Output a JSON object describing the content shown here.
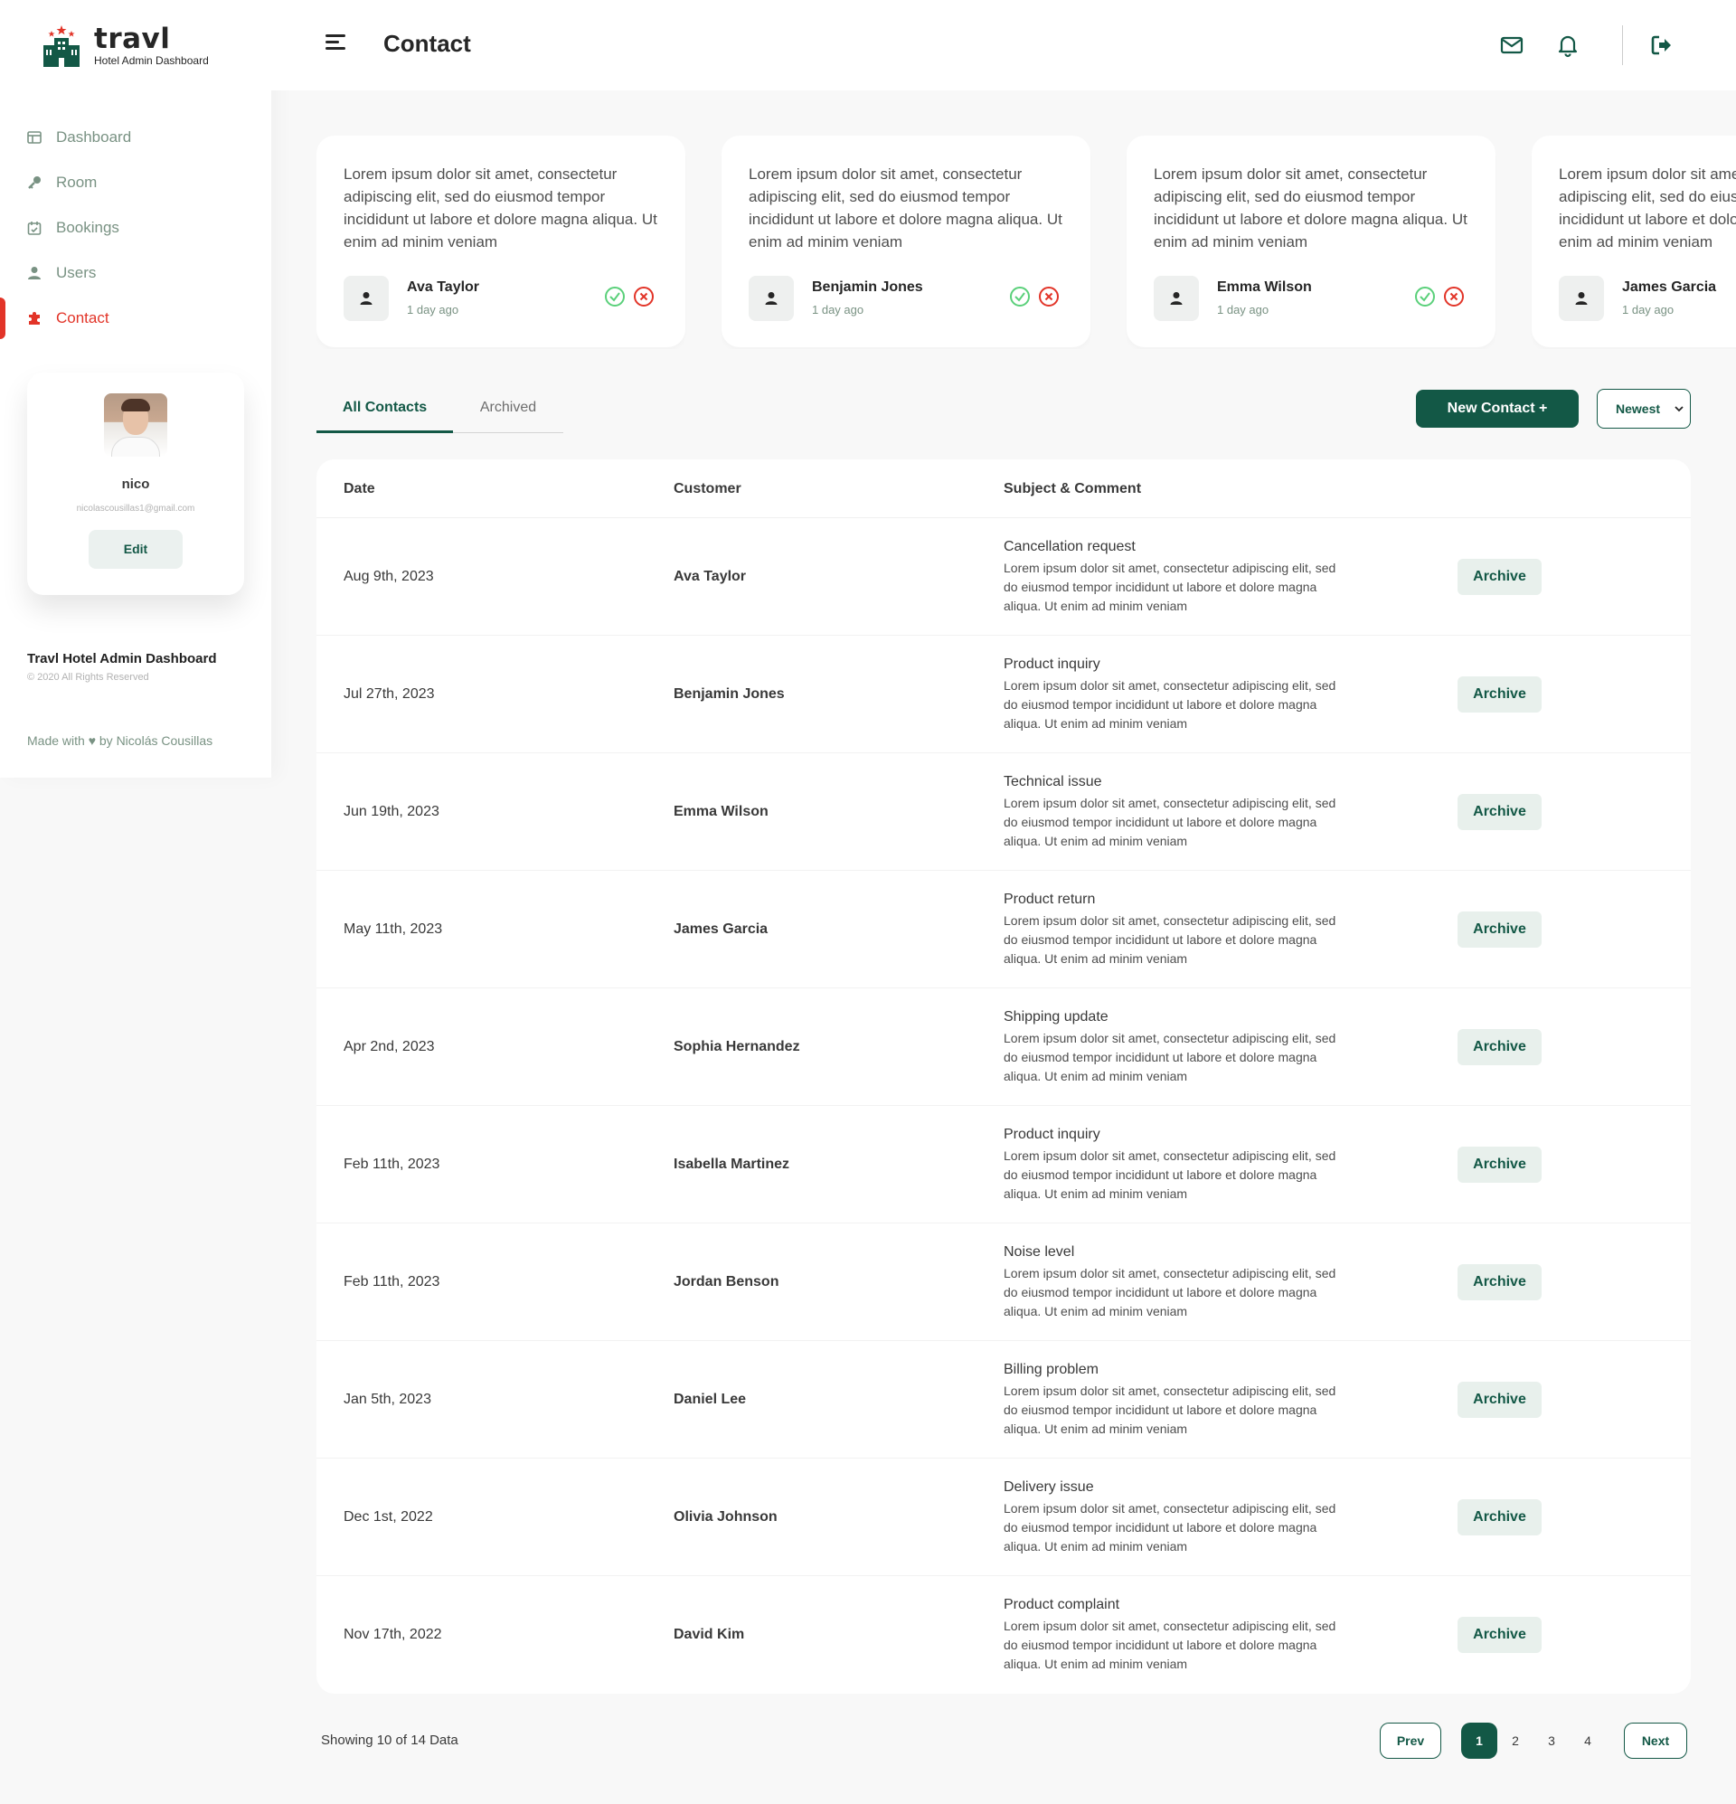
{
  "brand": {
    "name": "travl",
    "subtitle": "Hotel Admin Dashboard"
  },
  "sidebar": {
    "items": [
      {
        "label": "Dashboard",
        "icon": "dashboard-icon"
      },
      {
        "label": "Room",
        "icon": "key-icon"
      },
      {
        "label": "Bookings",
        "icon": "calendar-icon"
      },
      {
        "label": "Users",
        "icon": "user-icon"
      },
      {
        "label": "Contact",
        "icon": "puzzle-icon",
        "active": true
      }
    ],
    "user": {
      "name": "nico",
      "email": "nicolascousillas1@gmail.com",
      "edit_label": "Edit"
    },
    "footer": {
      "title": "Travl Hotel Admin Dashboard",
      "copyright": "© 2020 All Rights Reserved",
      "made": "Made with ♥ by Nicolás Cousillas"
    }
  },
  "header": {
    "title": "Contact"
  },
  "reviews": [
    {
      "text": "Lorem ipsum dolor sit amet, consectetur adipiscing elit, sed do eiusmod tempor incididunt ut labore et dolore magna aliqua. Ut enim ad minim veniam",
      "name": "Ava Taylor",
      "time": "1 day ago"
    },
    {
      "text": "Lorem ipsum dolor sit amet, consectetur adipiscing elit, sed do eiusmod tempor incididunt ut labore et dolore magna aliqua. Ut enim ad minim veniam",
      "name": "Benjamin Jones",
      "time": "1 day ago"
    },
    {
      "text": "Lorem ipsum dolor sit amet, consectetur adipiscing elit, sed do eiusmod tempor incididunt ut labore et dolore magna aliqua. Ut enim ad minim veniam",
      "name": "Emma Wilson",
      "time": "1 day ago"
    },
    {
      "text": "Lorem ipsum dolor sit amet, consectetur adipiscing elit, sed do eiusmod tempor incididunt ut labore et dolore magna aliqua. Ut enim ad minim veniam",
      "name": "James Garcia",
      "time": "1 day ago"
    }
  ],
  "tabs": {
    "all": "All Contacts",
    "archived": "Archived"
  },
  "controls": {
    "new_contact": "New Contact +",
    "sort": "Newest"
  },
  "table": {
    "headers": {
      "date": "Date",
      "customer": "Customer",
      "subject": "Subject & Comment"
    },
    "archive_label": "Archive",
    "rows": [
      {
        "date": "Aug 9th, 2023",
        "customer": "Ava Taylor",
        "subject": "Cancellation request",
        "comment": "Lorem ipsum dolor sit amet, consectetur adipiscing elit, sed do eiusmod tempor incididunt ut labore et dolore magna aliqua. Ut enim ad minim veniam"
      },
      {
        "date": "Jul 27th, 2023",
        "customer": "Benjamin Jones",
        "subject": "Product inquiry",
        "comment": "Lorem ipsum dolor sit amet, consectetur adipiscing elit, sed do eiusmod tempor incididunt ut labore et dolore magna aliqua. Ut enim ad minim veniam"
      },
      {
        "date": "Jun 19th, 2023",
        "customer": "Emma Wilson",
        "subject": "Technical issue",
        "comment": "Lorem ipsum dolor sit amet, consectetur adipiscing elit, sed do eiusmod tempor incididunt ut labore et dolore magna aliqua. Ut enim ad minim veniam"
      },
      {
        "date": "May 11th, 2023",
        "customer": "James Garcia",
        "subject": "Product return",
        "comment": "Lorem ipsum dolor sit amet, consectetur adipiscing elit, sed do eiusmod tempor incididunt ut labore et dolore magna aliqua. Ut enim ad minim veniam"
      },
      {
        "date": "Apr 2nd, 2023",
        "customer": "Sophia Hernandez",
        "subject": "Shipping update",
        "comment": "Lorem ipsum dolor sit amet, consectetur adipiscing elit, sed do eiusmod tempor incididunt ut labore et dolore magna aliqua. Ut enim ad minim veniam"
      },
      {
        "date": "Feb 11th, 2023",
        "customer": "Isabella Martinez",
        "subject": "Product inquiry",
        "comment": "Lorem ipsum dolor sit amet, consectetur adipiscing elit, sed do eiusmod tempor incididunt ut labore et dolore magna aliqua. Ut enim ad minim veniam"
      },
      {
        "date": "Feb 11th, 2023",
        "customer": "Jordan Benson",
        "subject": "Noise level",
        "comment": "Lorem ipsum dolor sit amet, consectetur adipiscing elit, sed do eiusmod tempor incididunt ut labore et dolore magna aliqua. Ut enim ad minim veniam"
      },
      {
        "date": "Jan 5th, 2023",
        "customer": "Daniel Lee",
        "subject": "Billing problem",
        "comment": "Lorem ipsum dolor sit amet, consectetur adipiscing elit, sed do eiusmod tempor incididunt ut labore et dolore magna aliqua. Ut enim ad minim veniam"
      },
      {
        "date": "Dec 1st, 2022",
        "customer": "Olivia Johnson",
        "subject": "Delivery issue",
        "comment": "Lorem ipsum dolor sit amet, consectetur adipiscing elit, sed do eiusmod tempor incididunt ut labore et dolore magna aliqua. Ut enim ad minim veniam"
      },
      {
        "date": "Nov 17th, 2022",
        "customer": "David Kim",
        "subject": "Product complaint",
        "comment": "Lorem ipsum dolor sit amet, consectetur adipiscing elit, sed do eiusmod tempor incididunt ut labore et dolore magna aliqua. Ut enim ad minim veniam"
      }
    ]
  },
  "pagination": {
    "showing": "Showing 10 of 14 Data",
    "prev": "Prev",
    "next": "Next",
    "pages": [
      "1",
      "2",
      "3",
      "4"
    ],
    "current": "1"
  },
  "colors": {
    "primary": "#135846",
    "accent": "#e23428",
    "muted": "#799283",
    "success": "#5ad07a"
  }
}
